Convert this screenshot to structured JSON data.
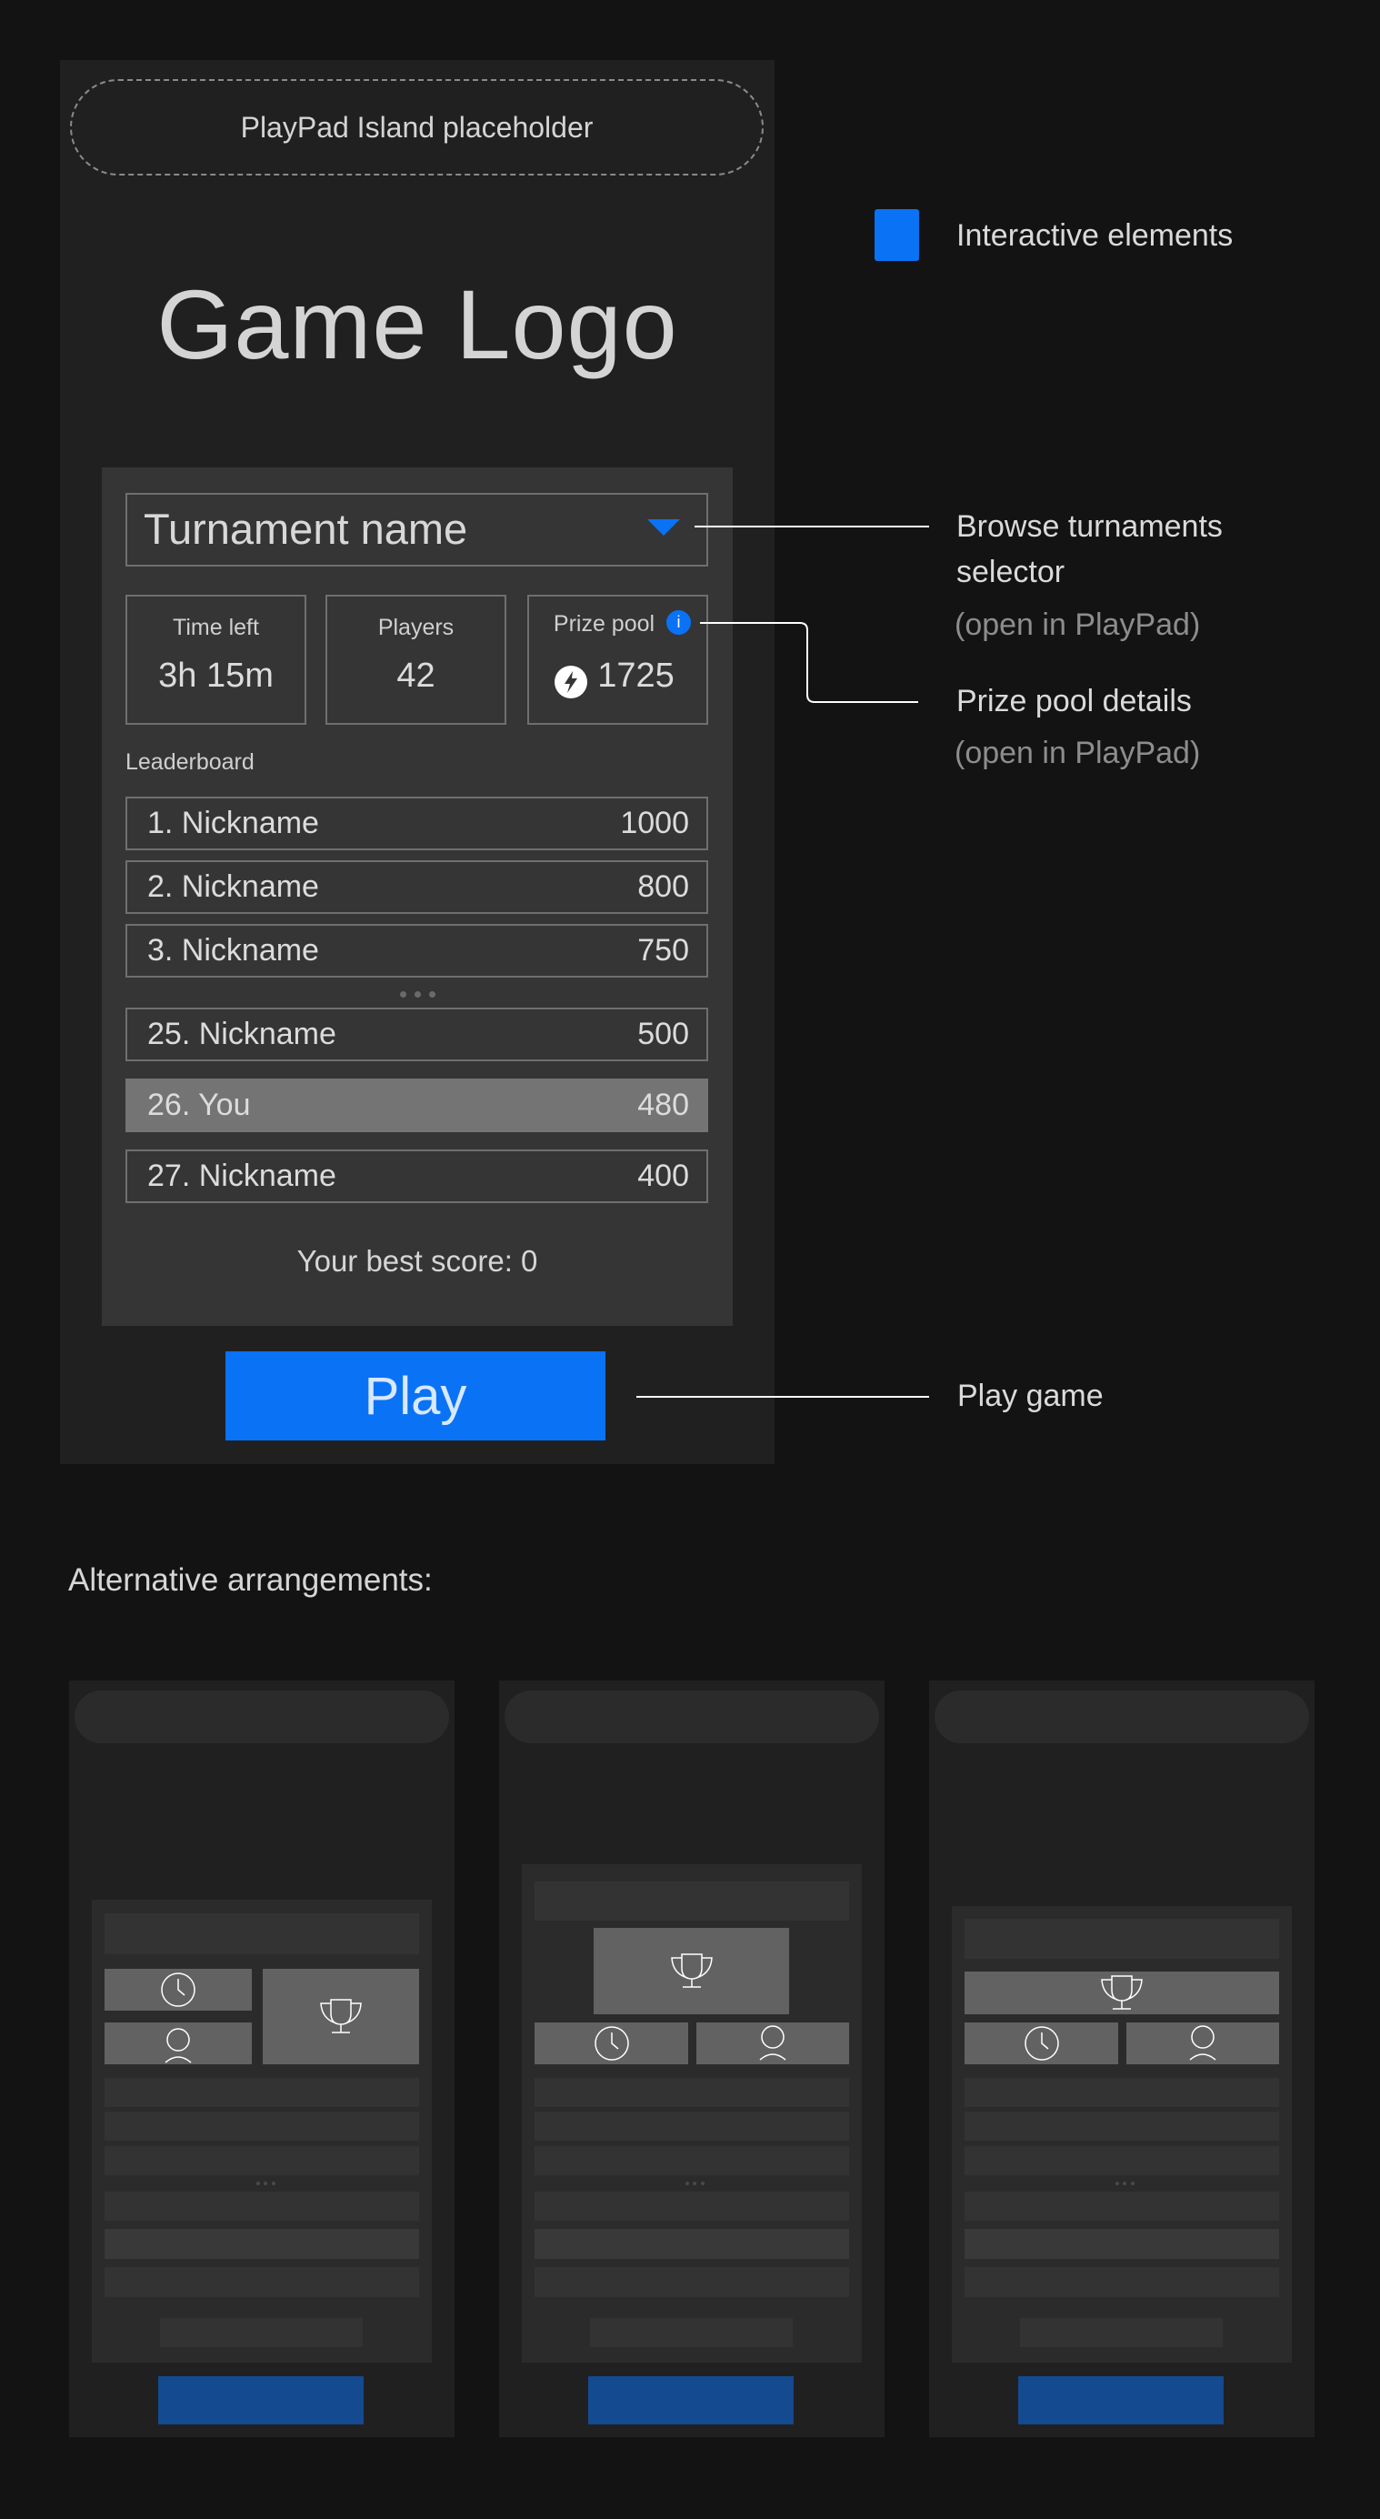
{
  "phone": {
    "island_placeholder": "PlayPad Island placeholder",
    "logo": "Game Logo",
    "selector": {
      "label": "Turnament name",
      "icon": "caret-down-icon"
    },
    "stats": [
      {
        "label": "Time left",
        "value": "3h 15m"
      },
      {
        "label": "Players",
        "value": "42"
      },
      {
        "label": "Prize pool",
        "value": "1725",
        "info_icon": "info-icon",
        "info_glyph": "i",
        "currency_icon": "bolt-coin-icon"
      }
    ],
    "leaderboard": {
      "label": "Leaderboard",
      "rows": [
        {
          "rank_name": "1. Nickname",
          "score": "1000",
          "highlight": false
        },
        {
          "rank_name": "2. Nickname",
          "score": "800",
          "highlight": false
        },
        {
          "rank_name": "3. Nickname",
          "score": "750",
          "highlight": false
        },
        {
          "rank_name": "25. Nickname",
          "score": "500",
          "highlight": false
        },
        {
          "rank_name": "26. You",
          "score": "480",
          "highlight": true
        },
        {
          "rank_name": "27. Nickname",
          "score": "400",
          "highlight": false
        }
      ]
    },
    "best_score": "Your best score: 0",
    "play_label": "Play"
  },
  "legend": {
    "label": "Interactive elements",
    "color": "#0a72f5"
  },
  "annotations": {
    "selector": {
      "title_line1": "Browse turnaments",
      "title_line2": "selector",
      "sub": "(open in PlayPad)"
    },
    "prize": {
      "title": "Prize pool details",
      "sub": "(open in PlayPad)"
    },
    "play": {
      "title": "Play game"
    }
  },
  "alternatives": {
    "title": "Alternative arrangements:",
    "variants": [
      {
        "name": "stats-left-trophy-right",
        "icons": [
          "clock-icon",
          "user-icon",
          "trophy-icon"
        ]
      },
      {
        "name": "trophy-top-centered",
        "icons": [
          "trophy-icon",
          "clock-icon",
          "user-icon"
        ]
      },
      {
        "name": "trophy-top-full-width",
        "icons": [
          "trophy-icon",
          "clock-icon",
          "user-icon"
        ]
      }
    ]
  },
  "colors": {
    "accent": "#0a72f5",
    "accent_muted": "#144a8f",
    "background": "#131313",
    "phone": "#202020",
    "panel": "#353535",
    "highlight_row": "#747474"
  }
}
